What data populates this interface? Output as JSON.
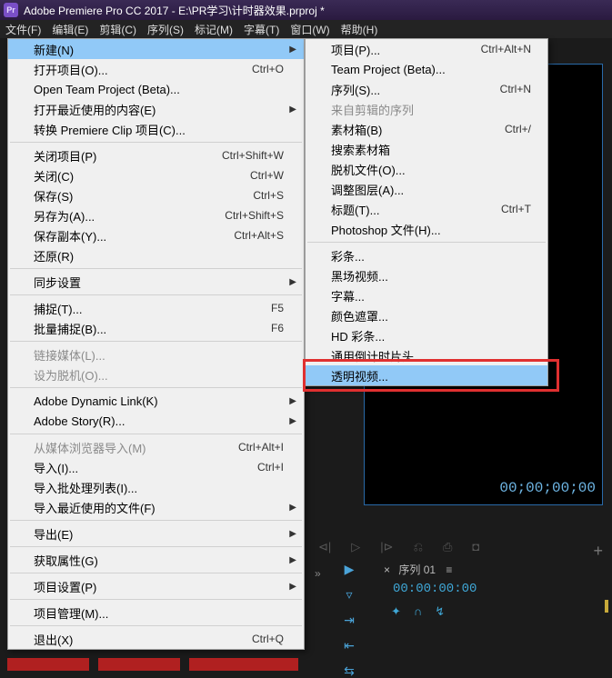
{
  "title": "Adobe Premiere Pro CC 2017 - E:\\PR学习\\计时器效果.prproj *",
  "logo_text": "Pr",
  "menubar": [
    "文件(F)",
    "编辑(E)",
    "剪辑(C)",
    "序列(S)",
    "标记(M)",
    "字幕(T)",
    "窗口(W)",
    "帮助(H)"
  ],
  "file_menu": [
    {
      "t": "item",
      "label": "新建(N)",
      "submenu": true,
      "highlight": true
    },
    {
      "t": "item",
      "label": "打开项目(O)...",
      "shortcut": "Ctrl+O"
    },
    {
      "t": "item",
      "label": "Open Team Project (Beta)..."
    },
    {
      "t": "item",
      "label": "打开最近使用的内容(E)",
      "submenu": true
    },
    {
      "t": "item",
      "label": "转换 Premiere Clip 项目(C)..."
    },
    {
      "t": "sep"
    },
    {
      "t": "item",
      "label": "关闭项目(P)",
      "shortcut": "Ctrl+Shift+W"
    },
    {
      "t": "item",
      "label": "关闭(C)",
      "shortcut": "Ctrl+W"
    },
    {
      "t": "item",
      "label": "保存(S)",
      "shortcut": "Ctrl+S"
    },
    {
      "t": "item",
      "label": "另存为(A)...",
      "shortcut": "Ctrl+Shift+S"
    },
    {
      "t": "item",
      "label": "保存副本(Y)...",
      "shortcut": "Ctrl+Alt+S"
    },
    {
      "t": "item",
      "label": "还原(R)"
    },
    {
      "t": "sep"
    },
    {
      "t": "item",
      "label": "同步设置",
      "submenu": true
    },
    {
      "t": "sep"
    },
    {
      "t": "item",
      "label": "捕捉(T)...",
      "shortcut": "F5"
    },
    {
      "t": "item",
      "label": "批量捕捉(B)...",
      "shortcut": "F6"
    },
    {
      "t": "sep"
    },
    {
      "t": "item",
      "label": "链接媒体(L)...",
      "disabled": true
    },
    {
      "t": "item",
      "label": "设为脱机(O)...",
      "disabled": true
    },
    {
      "t": "sep"
    },
    {
      "t": "item",
      "label": "Adobe Dynamic Link(K)",
      "submenu": true
    },
    {
      "t": "item",
      "label": "Adobe Story(R)...",
      "submenu": true
    },
    {
      "t": "sep"
    },
    {
      "t": "item",
      "label": "从媒体浏览器导入(M)",
      "shortcut": "Ctrl+Alt+I",
      "disabled": true
    },
    {
      "t": "item",
      "label": "导入(I)...",
      "shortcut": "Ctrl+I"
    },
    {
      "t": "item",
      "label": "导入批处理列表(I)..."
    },
    {
      "t": "item",
      "label": "导入最近使用的文件(F)",
      "submenu": true
    },
    {
      "t": "sep"
    },
    {
      "t": "item",
      "label": "导出(E)",
      "submenu": true
    },
    {
      "t": "sep"
    },
    {
      "t": "item",
      "label": "获取属性(G)",
      "submenu": true
    },
    {
      "t": "sep"
    },
    {
      "t": "item",
      "label": "项目设置(P)",
      "submenu": true
    },
    {
      "t": "sep"
    },
    {
      "t": "item",
      "label": "项目管理(M)..."
    },
    {
      "t": "sep"
    },
    {
      "t": "item",
      "label": "退出(X)",
      "shortcut": "Ctrl+Q"
    }
  ],
  "new_submenu": [
    {
      "t": "item",
      "label": "项目(P)...",
      "shortcut": "Ctrl+Alt+N"
    },
    {
      "t": "item",
      "label": "Team Project (Beta)..."
    },
    {
      "t": "item",
      "label": "序列(S)...",
      "shortcut": "Ctrl+N"
    },
    {
      "t": "item",
      "label": "来自剪辑的序列",
      "disabled": true
    },
    {
      "t": "item",
      "label": "素材箱(B)",
      "shortcut": "Ctrl+/"
    },
    {
      "t": "item",
      "label": "搜索素材箱"
    },
    {
      "t": "item",
      "label": "脱机文件(O)..."
    },
    {
      "t": "item",
      "label": "调整图层(A)..."
    },
    {
      "t": "item",
      "label": "标题(T)...",
      "shortcut": "Ctrl+T"
    },
    {
      "t": "item",
      "label": "Photoshop 文件(H)..."
    },
    {
      "t": "sep"
    },
    {
      "t": "item",
      "label": "彩条..."
    },
    {
      "t": "item",
      "label": "黑场视频..."
    },
    {
      "t": "item",
      "label": "字幕..."
    },
    {
      "t": "item",
      "label": "颜色遮罩..."
    },
    {
      "t": "item",
      "label": "HD 彩条..."
    },
    {
      "t": "item",
      "label": "通用倒计时片头..."
    },
    {
      "t": "item",
      "label": "透明视频...",
      "highlight": true
    }
  ],
  "timecode_main": "00;00;00;00",
  "sequence_tab": {
    "prefix": "×",
    "name": "序列 01",
    "suffix": "≡"
  },
  "timecode_seq": "00:00:00:00"
}
